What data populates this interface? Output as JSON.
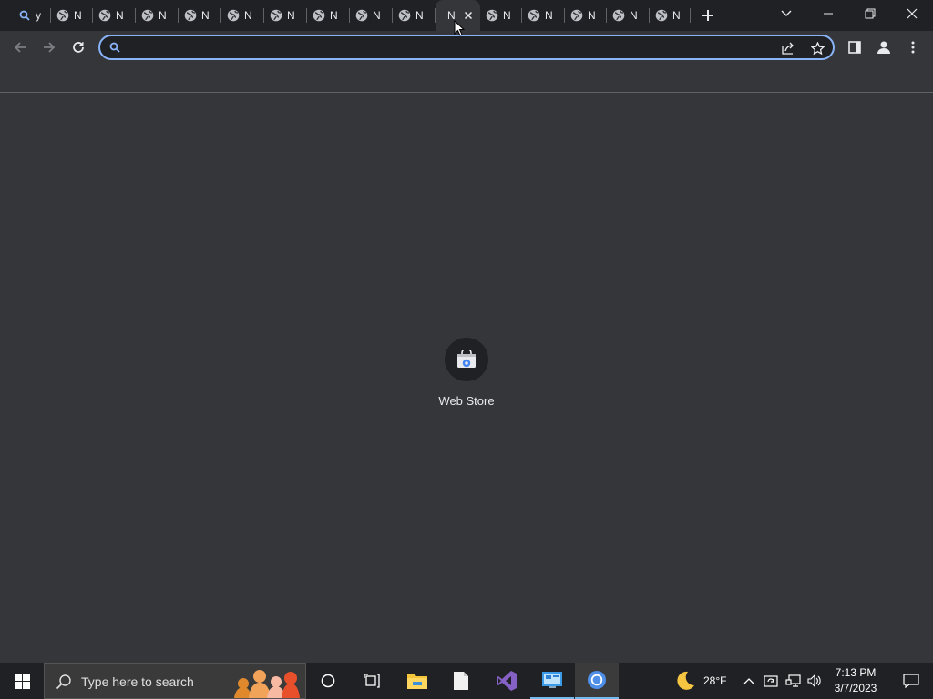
{
  "browser": {
    "tabs": [
      {
        "label": "y",
        "favicon": "search-icon",
        "active": false
      },
      {
        "label": "N",
        "favicon": "globe-icon",
        "active": false
      },
      {
        "label": "N",
        "favicon": "globe-icon",
        "active": false
      },
      {
        "label": "N",
        "favicon": "globe-icon",
        "active": false
      },
      {
        "label": "N",
        "favicon": "globe-icon",
        "active": false
      },
      {
        "label": "N",
        "favicon": "globe-icon",
        "active": false
      },
      {
        "label": "N",
        "favicon": "globe-icon",
        "active": false
      },
      {
        "label": "N",
        "favicon": "globe-icon",
        "active": false
      },
      {
        "label": "N",
        "favicon": "globe-icon",
        "active": false
      },
      {
        "label": "N",
        "favicon": "globe-icon",
        "active": false
      },
      {
        "label": "N",
        "favicon": "none",
        "active": true
      },
      {
        "label": "N",
        "favicon": "globe-icon",
        "active": false
      },
      {
        "label": "N",
        "favicon": "globe-icon",
        "active": false
      },
      {
        "label": "N",
        "favicon": "globe-icon",
        "active": false
      },
      {
        "label": "N",
        "favicon": "globe-icon",
        "active": false
      },
      {
        "label": "N",
        "favicon": "globe-icon",
        "active": false
      }
    ],
    "omnibox": {
      "value": "",
      "placeholder": ""
    },
    "accent": "#8ab4f8"
  },
  "new_tab_page": {
    "shortcuts": [
      {
        "label": "Web Store",
        "icon": "web-store-icon"
      }
    ]
  },
  "taskbar": {
    "search_placeholder": "Type here to search",
    "weather": {
      "temp": "28°F",
      "icon": "moon-icon"
    },
    "clock": {
      "time": "7:13 PM",
      "date": "3/7/2023"
    },
    "apps": [
      "cortana-icon",
      "task-view-icon",
      "file-explorer-icon",
      "notepad-icon",
      "visual-studio-icon",
      "control-panel-icon",
      "chrome-icon"
    ]
  }
}
